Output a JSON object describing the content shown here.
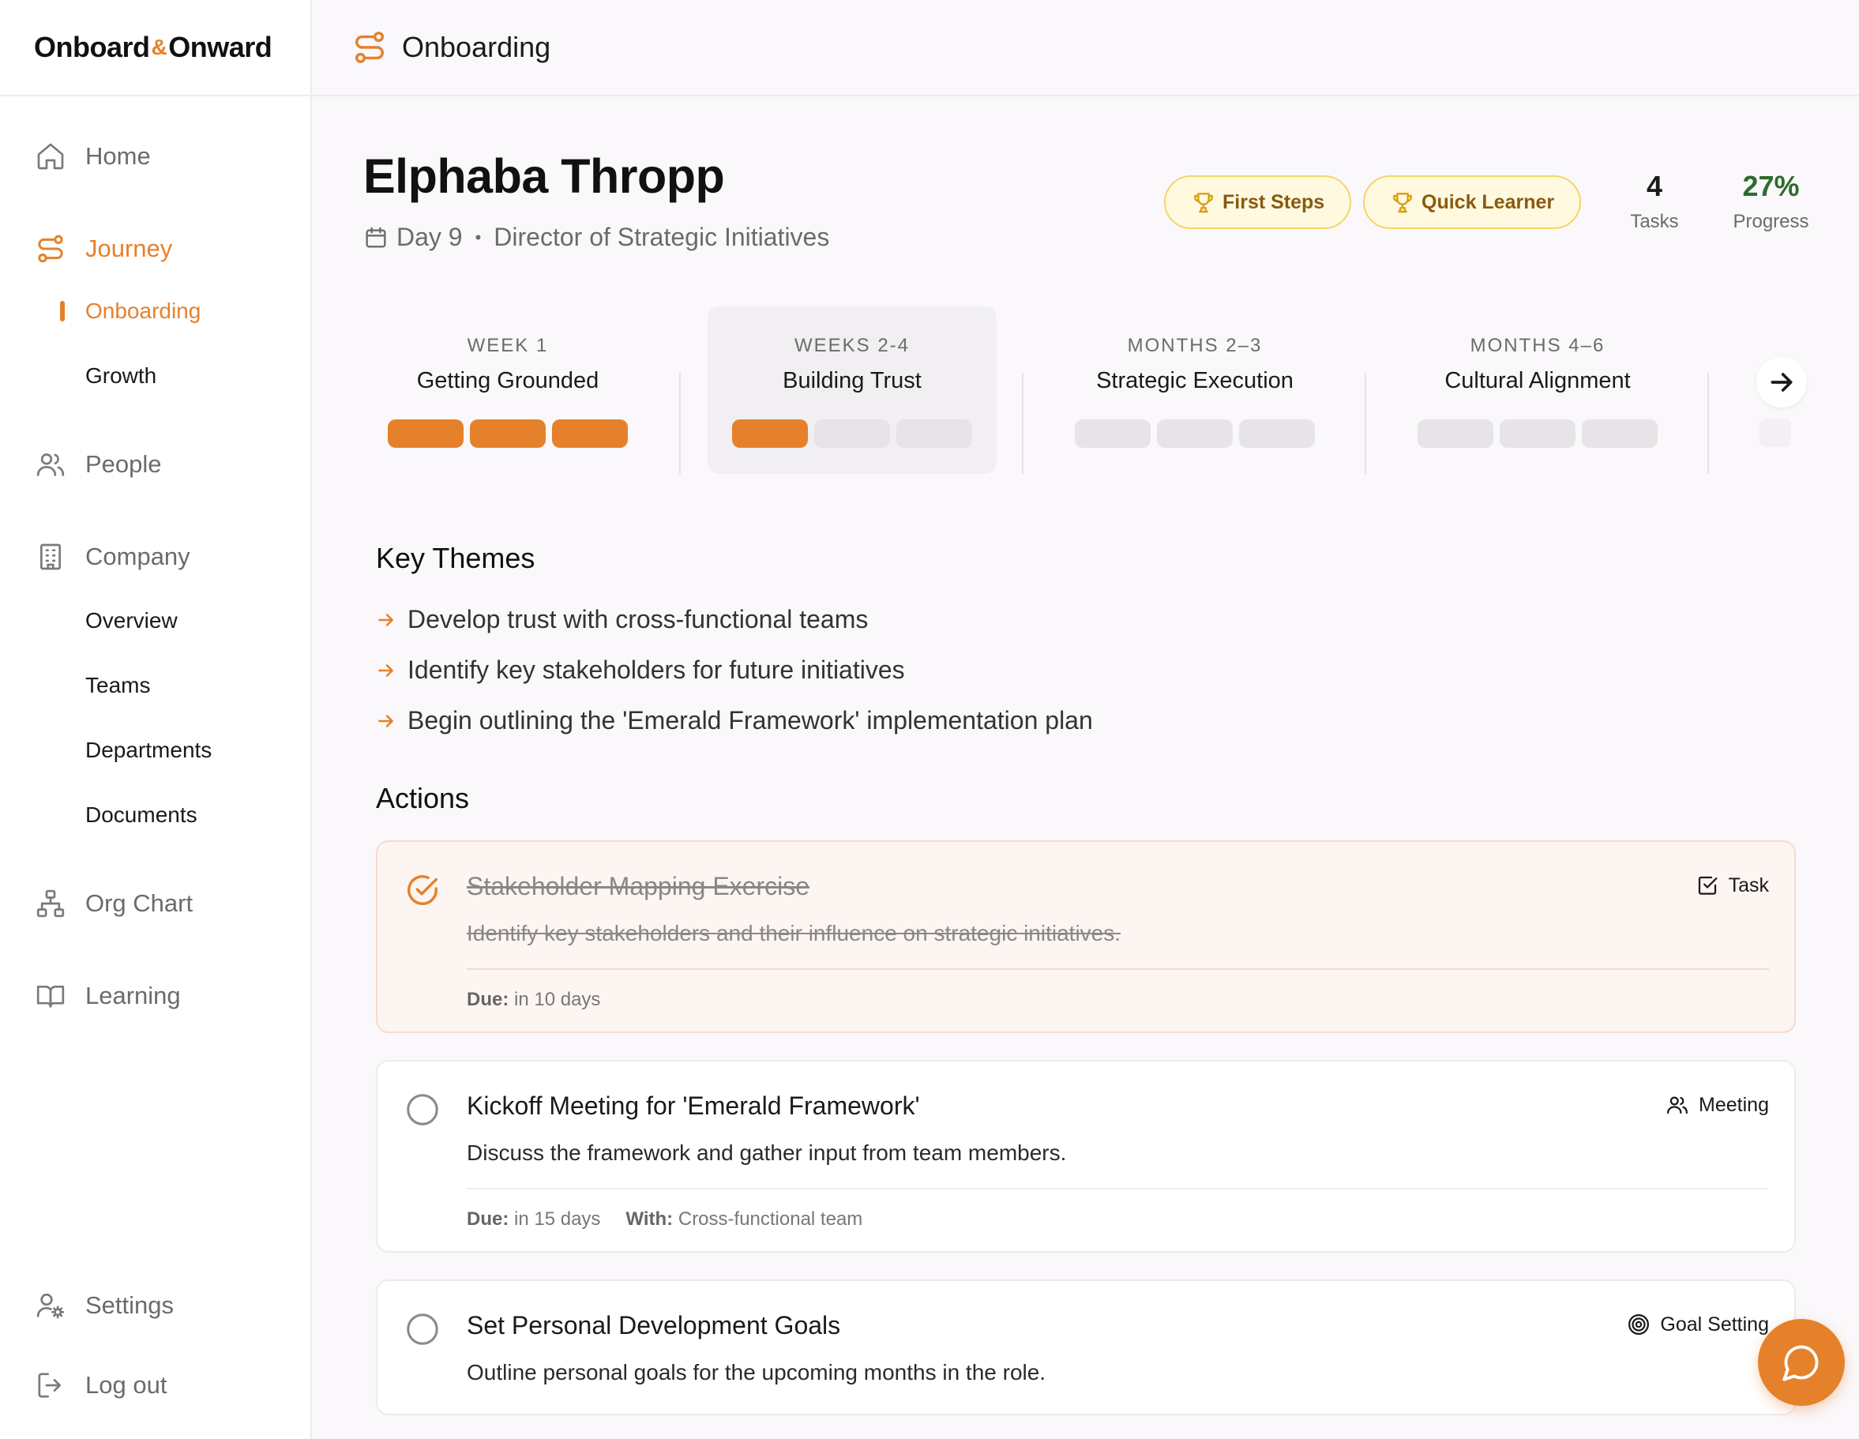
{
  "brand": {
    "part1": "Onboard",
    "amp": "&",
    "part2": "Onward"
  },
  "topbar": {
    "title": "Onboarding"
  },
  "sidebar": {
    "home": "Home",
    "journey": "Journey",
    "journey_sub": [
      "Onboarding",
      "Growth"
    ],
    "people": "People",
    "company": "Company",
    "company_sub": [
      "Overview",
      "Teams",
      "Departments",
      "Documents"
    ],
    "org_chart": "Org Chart",
    "learning": "Learning",
    "settings": "Settings",
    "logout": "Log out"
  },
  "profile": {
    "name": "Elphaba Thropp",
    "day": "Day 9",
    "dot": "•",
    "role": "Director of Strategic Initiatives",
    "badges": [
      "First Steps",
      "Quick Learner"
    ],
    "tasks_value": "4",
    "tasks_label": "Tasks",
    "progress_value": "27%",
    "progress_label": "Progress"
  },
  "phases": [
    {
      "label": "WEEK 1",
      "name": "Getting Grounded",
      "filled": 3,
      "total": 3
    },
    {
      "label": "WEEKS 2-4",
      "name": "Building Trust",
      "filled": 1,
      "total": 3
    },
    {
      "label": "MONTHS 2–3",
      "name": "Strategic Execution",
      "filled": 0,
      "total": 3
    },
    {
      "label": "MONTHS 4–6",
      "name": "Cultural Alignment",
      "filled": 0,
      "total": 3
    }
  ],
  "key_themes": {
    "heading": "Key Themes",
    "items": [
      "Develop trust with cross-functional teams",
      "Identify key stakeholders for future initiatives",
      "Begin outlining the 'Emerald Framework' implementation plan"
    ]
  },
  "actions": {
    "heading": "Actions",
    "items": [
      {
        "title": "Stakeholder Mapping Exercise",
        "desc": "Identify key stakeholders and their influence on strategic initiatives.",
        "type": "Task",
        "due_label": "Due:",
        "due": "in 10 days",
        "done": true
      },
      {
        "title": "Kickoff Meeting for 'Emerald Framework'",
        "desc": "Discuss the framework and gather input from team members.",
        "type": "Meeting",
        "due_label": "Due:",
        "due": "in 15 days",
        "with_label": "With:",
        "with": "Cross-functional team",
        "done": false
      },
      {
        "title": "Set Personal Development Goals",
        "desc": "Outline personal goals for the upcoming months in the role.",
        "type": "Goal Setting",
        "done": false
      }
    ]
  },
  "colors": {
    "accent": "#e5812b",
    "progress_green": "#2e6b2e",
    "badge_bg": "#fff9e0",
    "badge_border": "#f3d66a"
  }
}
